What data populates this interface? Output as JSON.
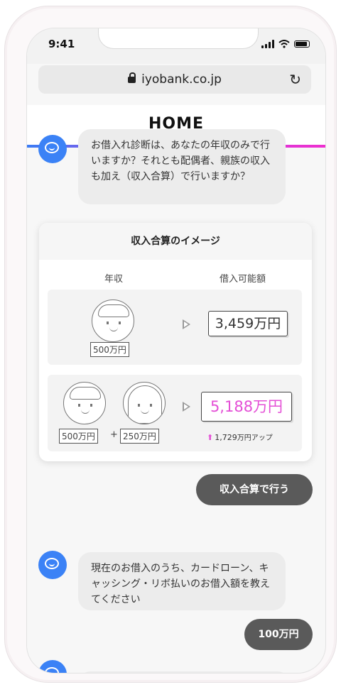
{
  "status": {
    "time": "9:41"
  },
  "browser": {
    "url": "iyobank.co.jp"
  },
  "header": {
    "title": "HOME"
  },
  "chat": {
    "bot_message_1": "お借入れ診断は、あなたの年収のみで行いますか？それとも配偶者、親族の収入も加え（収入合算）で行いますか？",
    "card": {
      "title": "収入合算のイメージ",
      "col_income": "年収",
      "col_limit": "借入可能額",
      "row1": {
        "income": "500万円",
        "amount": "3,459万円"
      },
      "row2": {
        "income_a": "500万円",
        "plus": "+",
        "income_b": "250万円",
        "amount": "5,188万円",
        "increase": "1,729",
        "increase_suffix": "万円アップ"
      }
    },
    "user_reply_1": "収入合算で行う",
    "bot_message_2": "現在のお借入のうち、カードローン、キャッシング・リボ払いのお借入額を教えてください",
    "user_reply_2": "100万円"
  },
  "colors": {
    "accent_blue": "#3b82f6",
    "accent_pink": "#e44fd6",
    "user_bubble": "#5a5a5a"
  },
  "icons": [
    "lock-icon",
    "reload-icon",
    "chat-bot-icon",
    "arrow-right-icon",
    "up-arrow-icon"
  ]
}
